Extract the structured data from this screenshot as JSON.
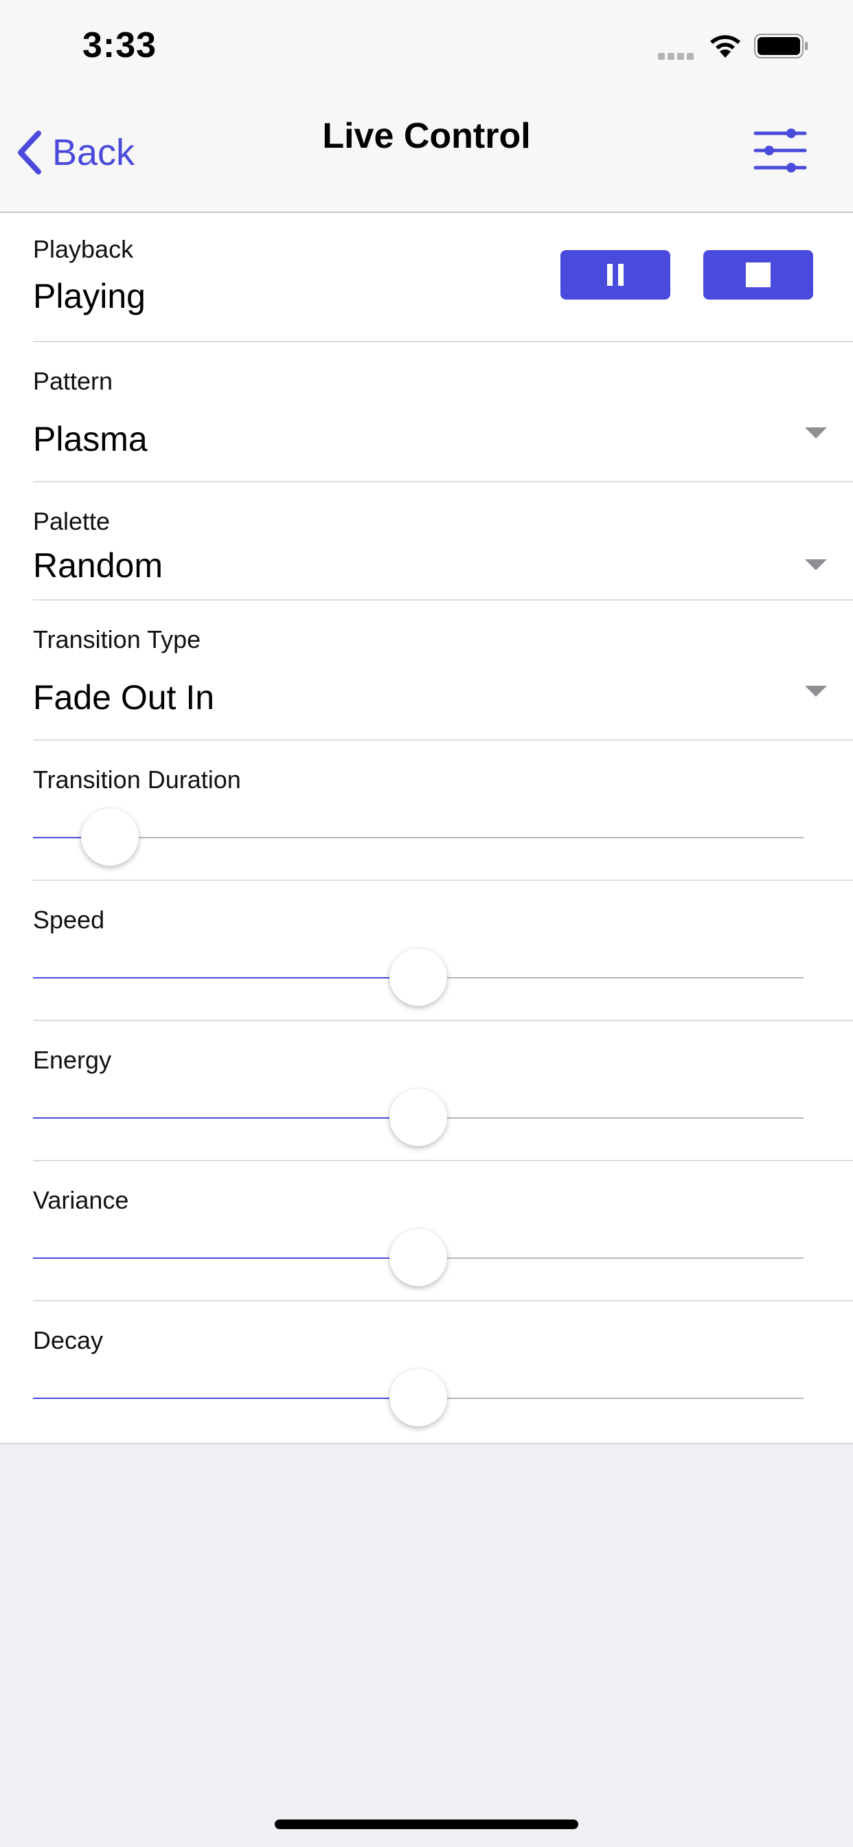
{
  "status_bar": {
    "time": "3:33"
  },
  "nav": {
    "back_label": "Back",
    "title": "Live Control"
  },
  "playback": {
    "label": "Playback",
    "value": "Playing"
  },
  "pattern": {
    "label": "Pattern",
    "value": "Plasma"
  },
  "palette": {
    "label": "Palette",
    "value": "Random"
  },
  "transition_type": {
    "label": "Transition Type",
    "value": "Fade Out In"
  },
  "sliders": [
    {
      "label": "Transition Duration",
      "value": 0.1
    },
    {
      "label": "Speed",
      "value": 0.5
    },
    {
      "label": "Energy",
      "value": 0.5
    },
    {
      "label": "Variance",
      "value": 0.5
    },
    {
      "label": "Decay",
      "value": 0.5
    }
  ],
  "colors": {
    "accent": "#4a4adc",
    "track": "#b8b8b8",
    "background": "#efeff4"
  }
}
